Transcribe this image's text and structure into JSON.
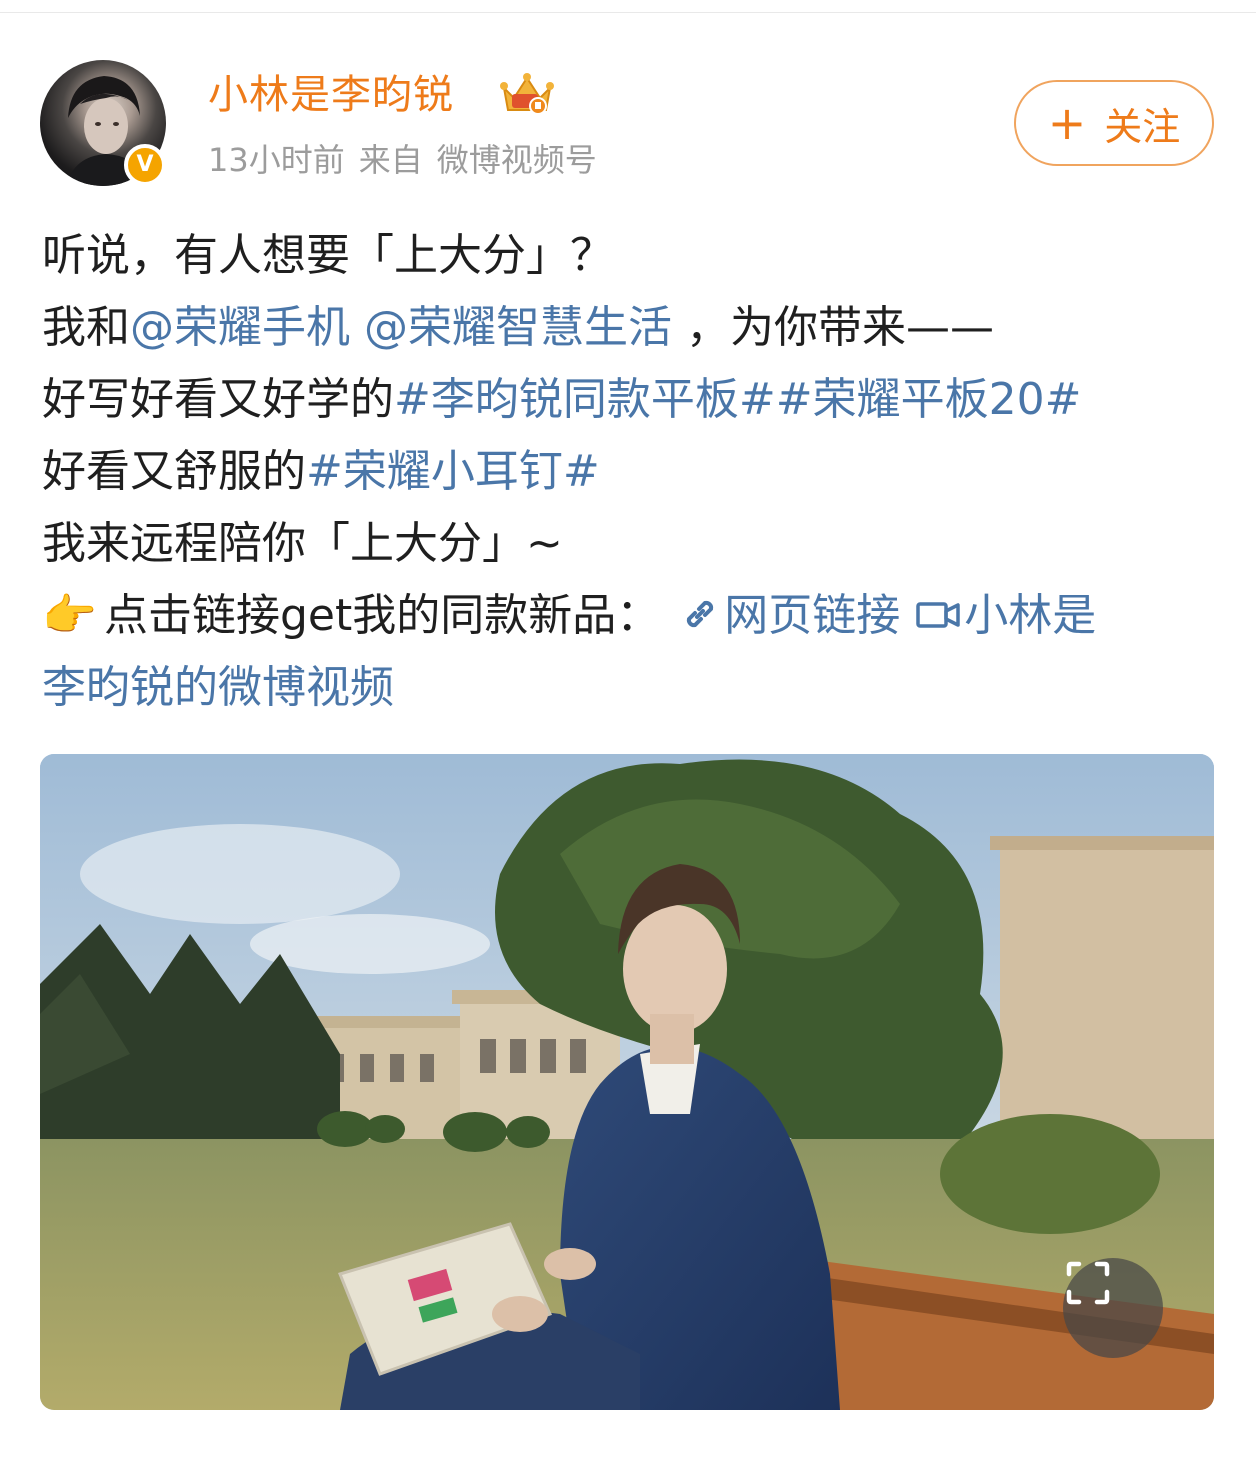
{
  "post": {
    "author": {
      "name": "小林是李昀锐",
      "avatar_icon": "avatar",
      "verified_icon": "v-verified-badge-icon",
      "vip_icon": "crown-badge-icon"
    },
    "meta": {
      "time": "13小时前",
      "source_prefix": "来自",
      "source": "微博视频号"
    },
    "follow_button": {
      "plus": "+",
      "label": "关注"
    },
    "text": {
      "line1": "听说，有人想要「上大分」？",
      "line2_prefix": "我和",
      "mention1": "@荣耀手机",
      "mention2": "@荣耀智慧生活",
      "line2_suffix": "，为你带来——",
      "line3_prefix": "好写好看又好学的",
      "topic1": "#李昀锐同款平板#",
      "topic2": "#荣耀平板20#",
      "line4_prefix": "好看又舒服的",
      "topic3": "#荣耀小耳钉#",
      "line5": "我来远程陪你「上大分」~",
      "line6_emoji": "👉",
      "line6_prefix": "点击链接get我的同款新品：",
      "web_link_icon": "link-icon",
      "web_link": "网页链接",
      "video_link_icon": "video-camera-icon",
      "video_link_part1": "小林是",
      "video_link_part2": "李昀锐的微博视频"
    },
    "video": {
      "thumbnail_icon": "video-thumbnail",
      "fullscreen_icon": "fullscreen-icon"
    }
  },
  "colors": {
    "username": "#ee7b1a",
    "link": "#4a76a8",
    "meta": "#9c9c9c",
    "follow_border": "#f0a45e"
  }
}
